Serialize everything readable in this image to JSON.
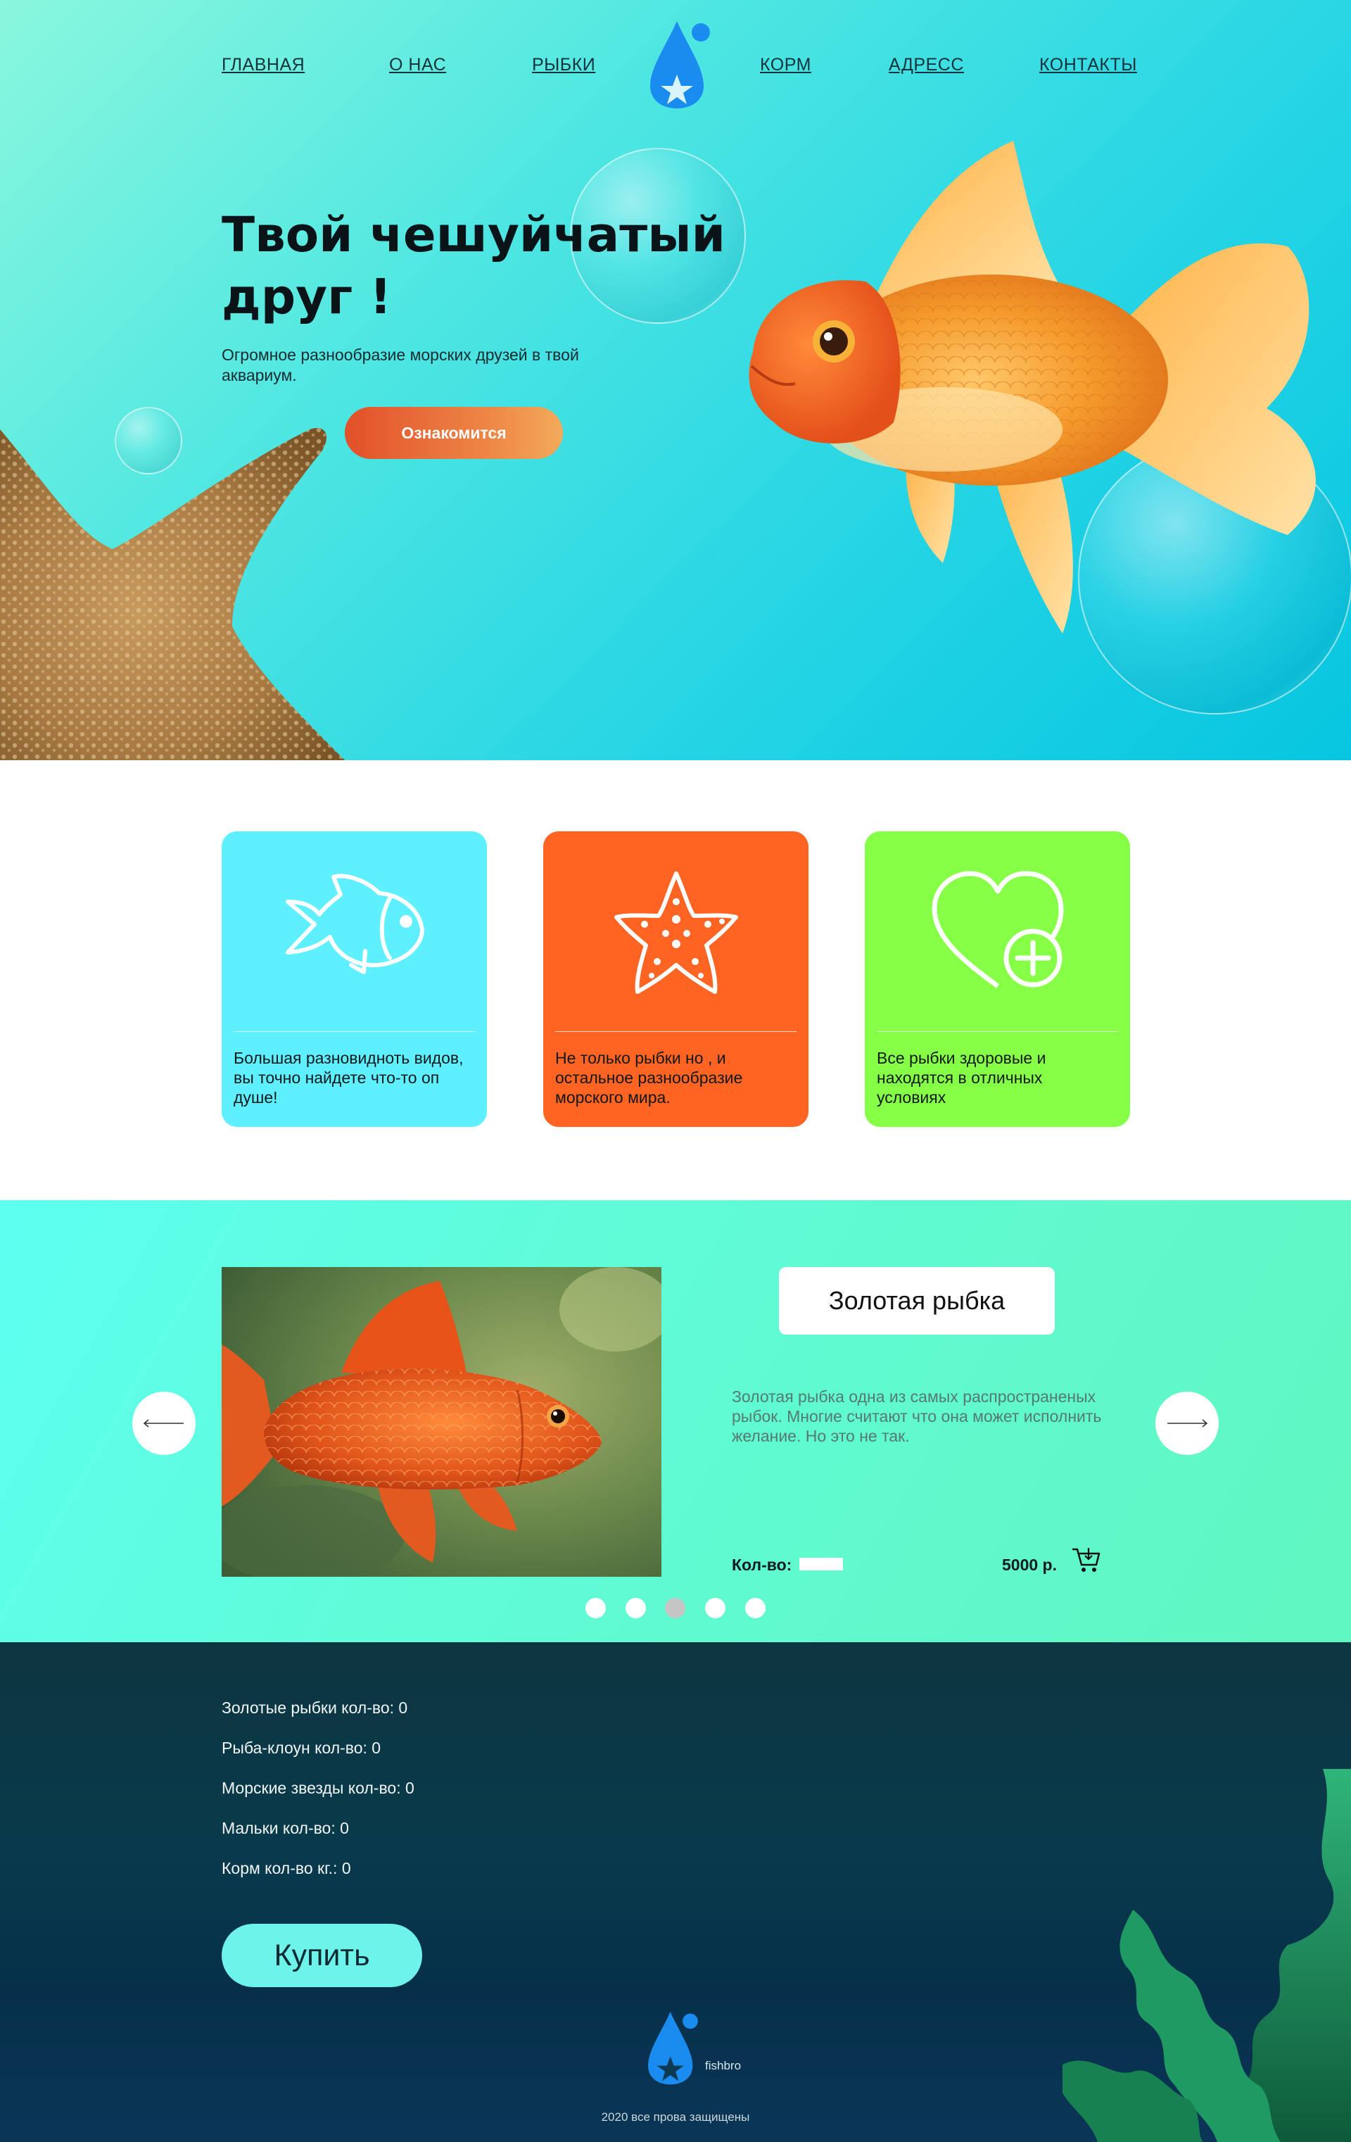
{
  "nav": {
    "items": [
      "ГЛАВНАЯ",
      "О НАС",
      "РЫБКИ",
      "КОРМ",
      "АДРЕСС",
      "КОНТАКТЫ"
    ]
  },
  "hero": {
    "title": "Твой чешуйчатый друг !",
    "subtitle": "Огромное разнообразие морских друзей в твой аквариум.",
    "button": "Ознакомится"
  },
  "features": [
    {
      "icon": "fish-icon",
      "color": "#5ef0ff",
      "text": "Большая разновидноть видов, вы точно найдете что-то оп душе!"
    },
    {
      "icon": "starfish-icon",
      "color": "#ff6422",
      "text": "Не только рыбки но , и остальное разнообразие морского мира."
    },
    {
      "icon": "heart-plus-icon",
      "color": "#86ff47",
      "text": "Все рыбки здоровые и находятся в отличных условиях"
    }
  ],
  "product": {
    "name": "Золотая рыбка",
    "description": "Золотая рыбка одна из самых распространеных рыбок. Многие считают что она может исполнить желание. Но это не так.",
    "qty_label": "Кол-во:",
    "price": "5000 р.",
    "slides": 5,
    "active_slide": 3
  },
  "order": {
    "lines": [
      "Золотые рыбки кол-во: 0",
      "Рыба-клоун кол-во: 0",
      "Морские звезды кол-во: 0",
      "Мальки кол-во: 0",
      "Корм кол-во кг.: 0"
    ],
    "buy_button": "Купить"
  },
  "footer": {
    "brand": "fishbro",
    "copyright": "2020 все прова защищены"
  },
  "colors": {
    "accent_orange": "#e2502a",
    "logo_blue": "#1a8cf0",
    "buy_button": "#6ef3ea"
  }
}
